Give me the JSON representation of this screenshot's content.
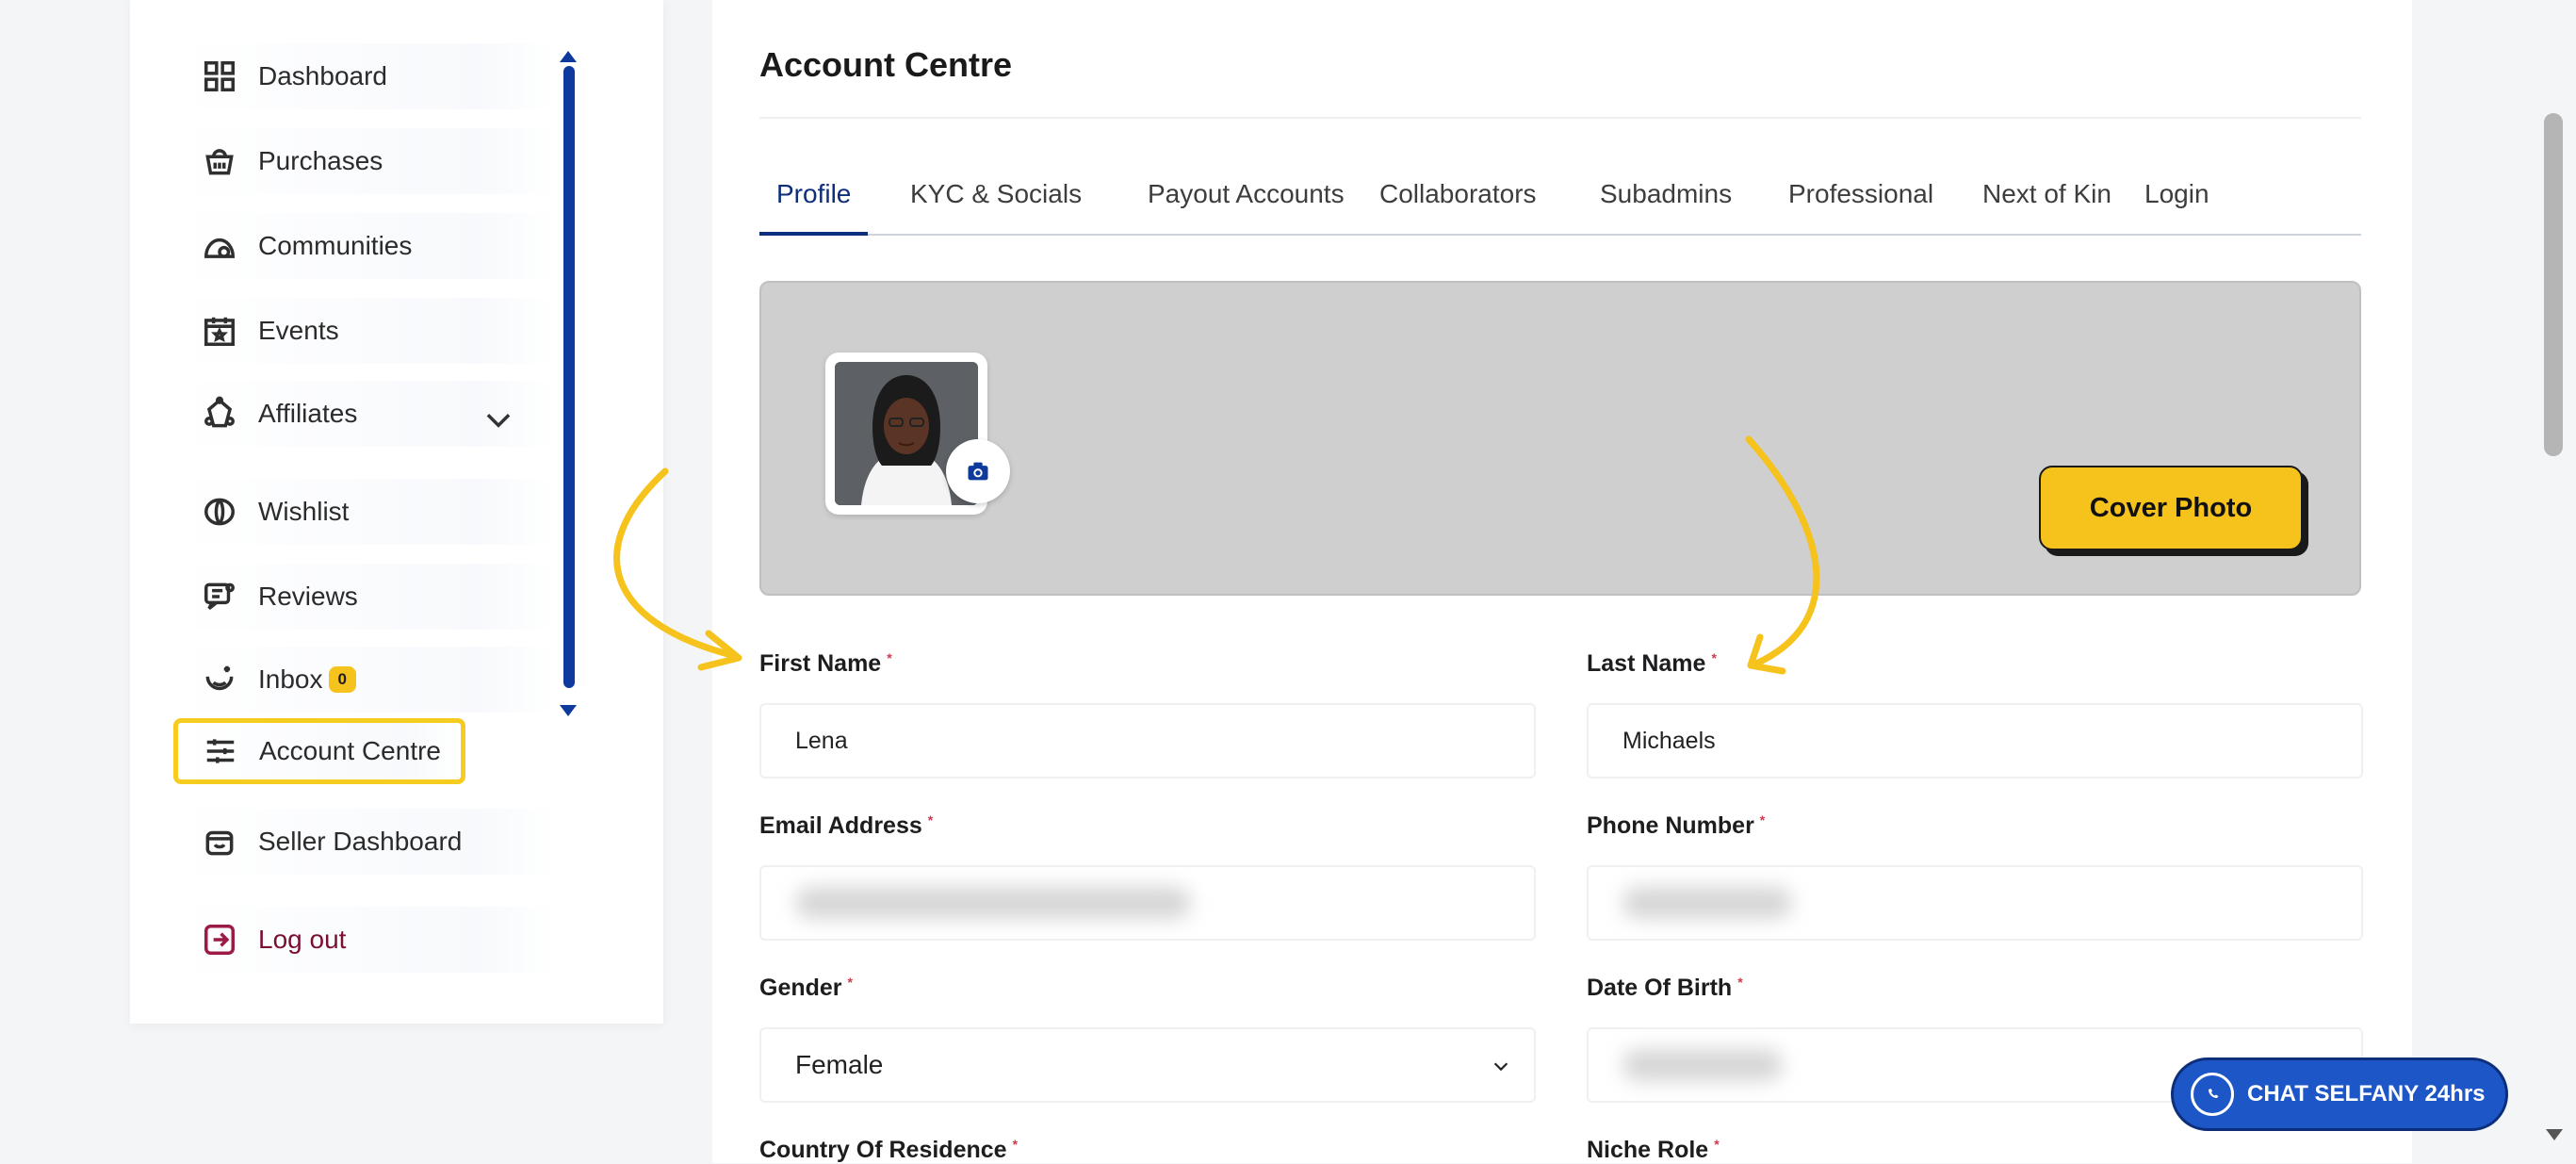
{
  "sidebar": {
    "items": [
      {
        "label": "Dashboard",
        "icon": "grid-icon"
      },
      {
        "label": "Purchases",
        "icon": "basket-icon"
      },
      {
        "label": "Communities",
        "icon": "community-icon"
      },
      {
        "label": "Events",
        "icon": "calendar-icon"
      },
      {
        "label": "Affiliates",
        "icon": "affiliates-icon"
      },
      {
        "label": "Wishlist",
        "icon": "wishlist-icon"
      },
      {
        "label": "Reviews",
        "icon": "reviews-icon"
      },
      {
        "label": "Inbox",
        "icon": "inbox-icon",
        "badge": "0"
      },
      {
        "label": "Account Centre",
        "icon": "sliders-icon",
        "active": true
      },
      {
        "label": "Seller Dashboard",
        "icon": "seller-icon"
      },
      {
        "label": "Log out",
        "icon": "logout-icon"
      }
    ]
  },
  "main": {
    "title": "Account Centre",
    "tabs": [
      "Profile",
      "KYC & Socials",
      "Payout Accounts",
      "Collaborators",
      "Subadmins",
      "Professional",
      "Next of Kin",
      "Login"
    ],
    "active_tab": "Profile",
    "cover_button": "Cover Photo",
    "fields": {
      "first_name": {
        "label": "First Name",
        "value": "Lena"
      },
      "last_name": {
        "label": "Last Name",
        "value": "Michaels"
      },
      "email": {
        "label": "Email Address",
        "value": ""
      },
      "phone": {
        "label": "Phone Number",
        "value": ""
      },
      "gender": {
        "label": "Gender",
        "value": "Female"
      },
      "dob": {
        "label": "Date Of Birth",
        "value": ""
      },
      "country": {
        "label": "Country Of Residence"
      },
      "niche": {
        "label": "Niche Role"
      }
    },
    "required_mark": "*"
  },
  "chat": {
    "label": "CHAT SELFANY 24hrs"
  },
  "colors": {
    "brand_blue": "#0d2e7a",
    "accent_yellow": "#f6c21c",
    "highlight": "#f6cc21"
  }
}
